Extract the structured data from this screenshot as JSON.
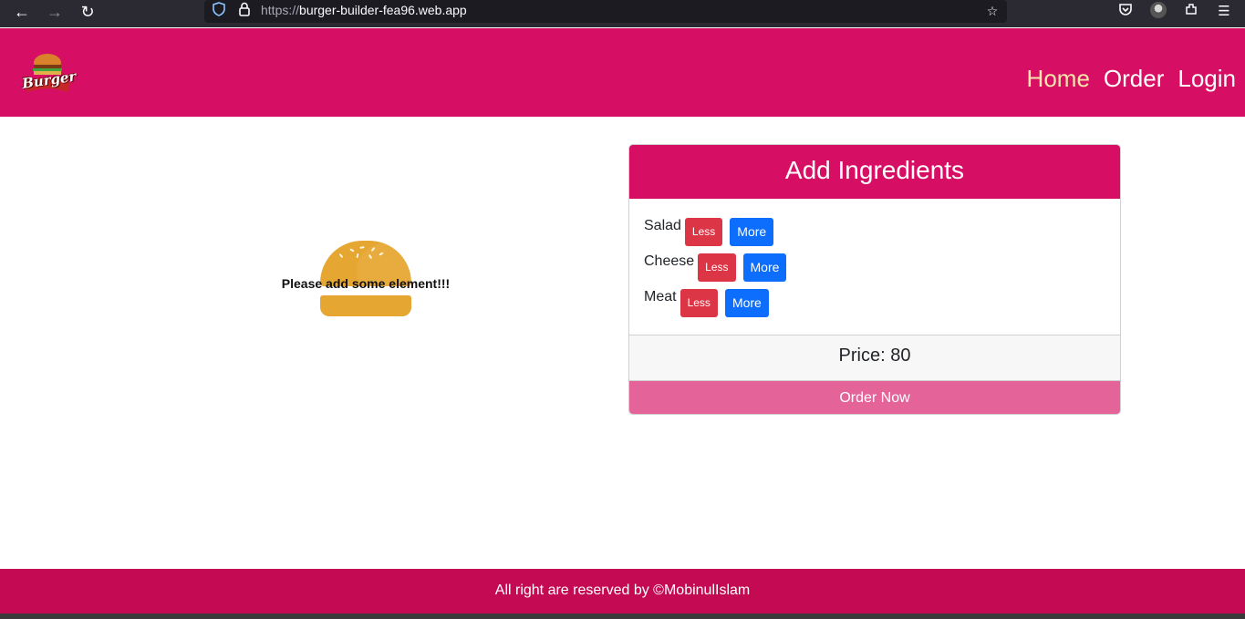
{
  "browser": {
    "url_scheme": "https://",
    "url_host": "burger-builder-fea96.web.app",
    "back_icon": "arrow-left-icon",
    "forward_icon": "arrow-right-icon",
    "reload_icon": "reload-icon"
  },
  "header": {
    "logo_text": "Burger",
    "nav": [
      {
        "label": "Home",
        "active": true
      },
      {
        "label": "Order",
        "active": false
      },
      {
        "label": "Login",
        "active": false
      }
    ]
  },
  "burger": {
    "message": "Please add some element!!!"
  },
  "controls": {
    "title": "Add Ingredients",
    "ingredients": [
      {
        "label": "Salad",
        "less": "Less",
        "more": "More"
      },
      {
        "label": "Cheese",
        "less": "Less",
        "more": "More"
      },
      {
        "label": "Meat",
        "less": "Less",
        "more": "More"
      }
    ],
    "price_text": "Price: 80",
    "order_label": "Order Now"
  },
  "footer": {
    "text": "All right are reserved by ©MobinulIslam"
  },
  "colors": {
    "brand": "#d70f64",
    "less": "#dc3545",
    "more": "#0d6efd",
    "order": "#e46499",
    "bun": "#e6a632"
  }
}
